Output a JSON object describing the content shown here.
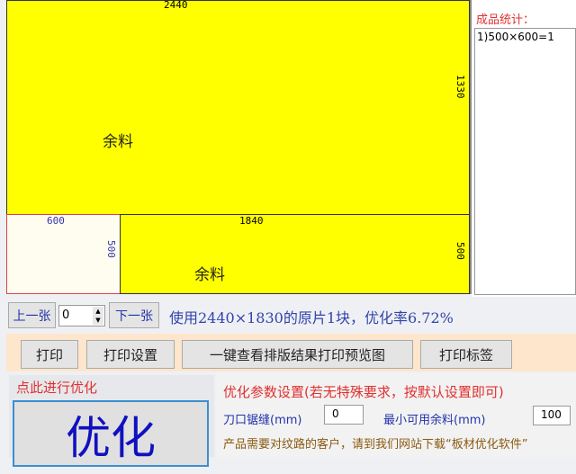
{
  "sheet": {
    "top_width": "2440",
    "top_height": "1330",
    "top_label": "余料",
    "part_width": "600",
    "part_height": "500",
    "rest_width": "1840",
    "rest_height": "500",
    "rest_label": "余料"
  },
  "stats": {
    "title": "成品统计：",
    "items": [
      "1)500×600=1"
    ]
  },
  "nav": {
    "prev": "上一张",
    "page": "0",
    "next": "下一张",
    "summary": "使用2440×1830的原片1块，优化率6.72%"
  },
  "toolbar": {
    "print": "打印",
    "print_settings": "打印设置",
    "preview": "一键查看排版结果打印预览图",
    "print_labels": "打印标签"
  },
  "optimize": {
    "title": "点此进行优化",
    "button": "优化"
  },
  "params": {
    "title": "优化参数设置(若无特殊要求，按默认设置即可)",
    "kerf_label": "刀口锯缝(mm)",
    "kerf_value": "0",
    "min_label": "最小可用余料(mm)",
    "min_value": "100",
    "note": "产品需要对纹路的客户，请到我们网站下载“板材优化软件”"
  }
}
